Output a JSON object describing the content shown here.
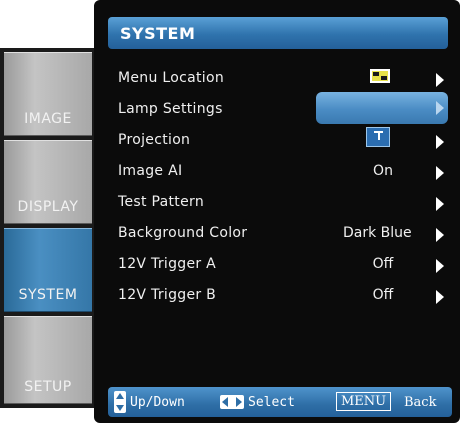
{
  "tabs": [
    {
      "label": "IMAGE",
      "active": false
    },
    {
      "label": "DISPLAY",
      "active": false
    },
    {
      "label": "SYSTEM",
      "active": true
    },
    {
      "label": "SETUP",
      "active": false
    }
  ],
  "panel": {
    "title": "SYSTEM"
  },
  "menu": [
    {
      "label": "Menu Location",
      "value": "",
      "icon": "menu-location-icon"
    },
    {
      "label": "Lamp Settings",
      "value": "",
      "highlighted": true
    },
    {
      "label": "Projection",
      "value": "",
      "icon": "projection-icon"
    },
    {
      "label": "Image AI",
      "value": "On"
    },
    {
      "label": "Test Pattern",
      "value": ""
    },
    {
      "label": "Background Color",
      "value": "Dark Blue"
    },
    {
      "label": "12V Trigger A",
      "value": "Off"
    },
    {
      "label": "12V Trigger B",
      "value": "Off"
    }
  ],
  "footer": {
    "updown_label": "Up/Down",
    "select_label": "Select",
    "menu_key": "MENU",
    "back_label": "Back"
  },
  "colors": {
    "accent": "#2f73ad",
    "highlight": "#4a8cc4",
    "panel_bg": "#0b0b0b"
  }
}
